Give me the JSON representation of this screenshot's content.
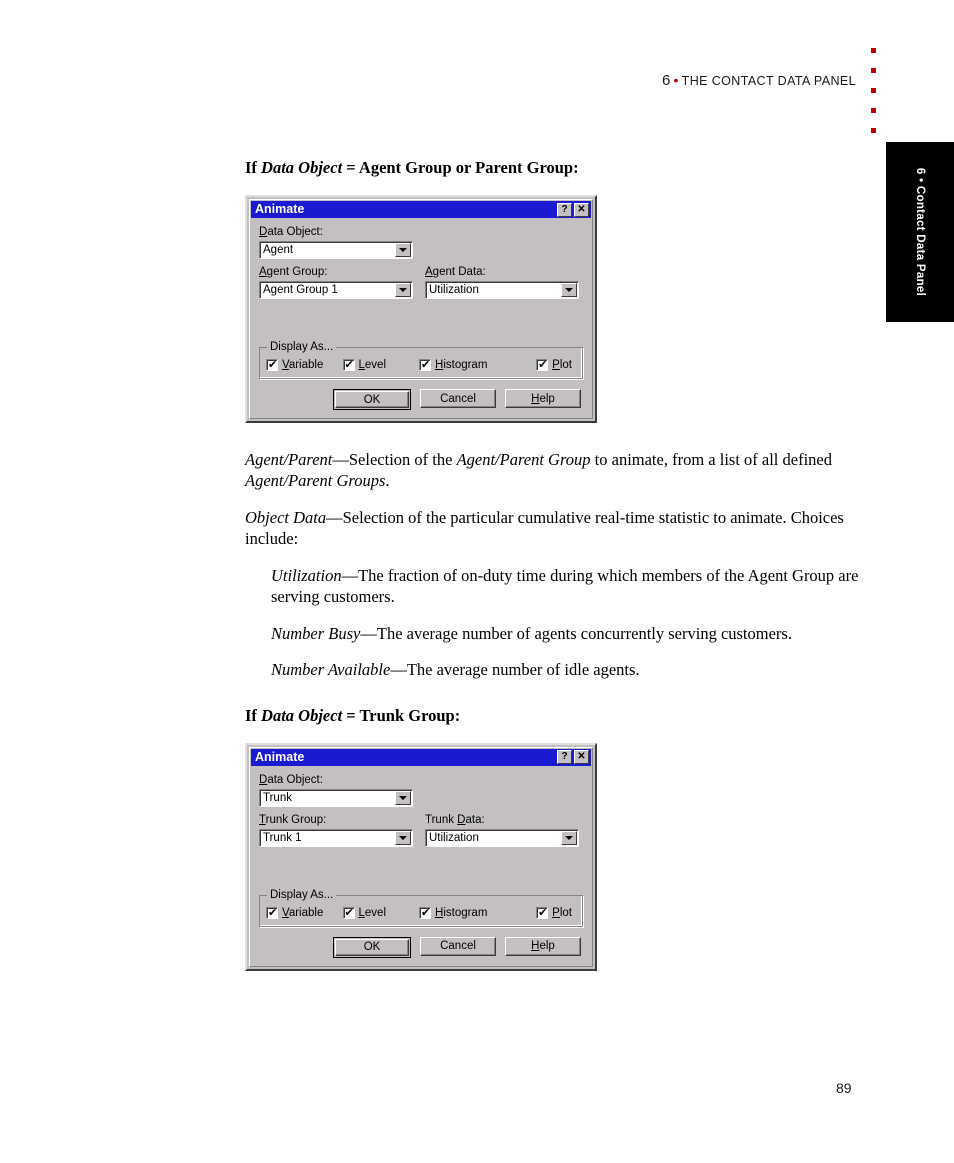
{
  "header": {
    "chapter_number": "6",
    "separator": "•",
    "title": "THE CONTACT DATA PANEL"
  },
  "chapter_tab": {
    "label": "6 • Contact Data Panel",
    "background": "#000000",
    "text_color": "#ffffff"
  },
  "margin_dots": {
    "count": 5,
    "color": "#c10000"
  },
  "headings": {
    "agent_group": "If Data Object = Agent Group or Parent Group:",
    "agent_group_prefix": "If ",
    "agent_group_italic": "Data Object",
    "agent_group_suffix": " = Agent Group or Parent Group:",
    "trunk_group_prefix": "If ",
    "trunk_group_italic": "Data Object",
    "trunk_group_suffix": " = Trunk Group:"
  },
  "body": {
    "para1_term": "Agent/Parent",
    "para1_text_a": "—Selection of the ",
    "para1_italic_b": "Agent/Parent Group",
    "para1_text_c": " to animate, from a list of all defined ",
    "para1_italic_d": "Agent/Parent Groups",
    "para1_text_e": ".",
    "para2_term": "Object Data",
    "para2_text": "—Selection of the particular cumulative real-time statistic to animate. Choices include:",
    "item1_term": "Utilization",
    "item1_text": "—The fraction of on-duty time during which members of the Agent Group are serving customers.",
    "item2_term": "Number Busy",
    "item2_text": "—The average number of agents concurrently serving customers.",
    "item3_term": "Number Available",
    "item3_text": "—The average number of idle agents."
  },
  "dialog_agent": {
    "title": "Animate",
    "titlebar_color": "#1a1ad2",
    "help_button": "?",
    "close_button": "✕",
    "data_object_label_u": "D",
    "data_object_label_rest": "ata Object:",
    "data_object_value": "Agent",
    "group_label_u": "A",
    "group_label_rest": "gent Group:",
    "group_value": "Agent Group 1",
    "data_label_u": "A",
    "data_label_rest": "gent Data:",
    "data_value": "Utilization",
    "groupbox_title": "Display As...",
    "checkboxes": [
      {
        "label_u": "V",
        "label_rest": "ariable",
        "checked": true,
        "tick": "✔"
      },
      {
        "label_u": "L",
        "label_rest": "evel",
        "checked": true,
        "tick": "✔"
      },
      {
        "label_u": "H",
        "label_rest": "istogram",
        "checked": true,
        "tick": "✔"
      },
      {
        "label_u": "P",
        "label_rest": "lot",
        "checked": true,
        "tick": "✔"
      }
    ],
    "ok_label": "OK",
    "cancel_label": "Cancel",
    "help_label_u": "H",
    "help_label_rest": "elp"
  },
  "dialog_trunk": {
    "title": "Animate",
    "titlebar_color": "#1a1ad2",
    "help_button": "?",
    "close_button": "✕",
    "data_object_label_u": "D",
    "data_object_label_rest": "ata Object:",
    "data_object_value": "Trunk",
    "group_label_u": "T",
    "group_label_rest": "runk Group:",
    "group_value": "Trunk 1",
    "data_label_pre": "Trunk ",
    "data_label_u": "D",
    "data_label_rest": "ata:",
    "data_value": "Utilization",
    "groupbox_title": "Display As...",
    "checkboxes": [
      {
        "label_u": "V",
        "label_rest": "ariable",
        "checked": true,
        "tick": "✔"
      },
      {
        "label_u": "L",
        "label_rest": "evel",
        "checked": true,
        "tick": "✔"
      },
      {
        "label_u": "H",
        "label_rest": "istogram",
        "checked": true,
        "tick": "✔"
      },
      {
        "label_u": "P",
        "label_rest": "lot",
        "checked": true,
        "tick": "✔"
      }
    ],
    "ok_label": "OK",
    "cancel_label": "Cancel",
    "help_label_u": "H",
    "help_label_rest": "elp"
  },
  "page_number": "89"
}
